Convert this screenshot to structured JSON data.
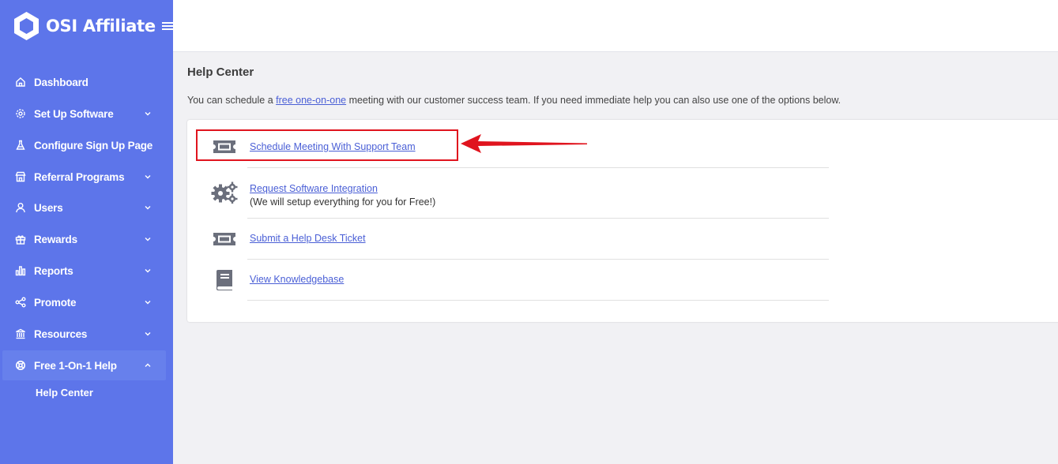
{
  "app": {
    "name": "OSI Affiliate"
  },
  "sidebar": {
    "items": [
      {
        "label": "Dashboard",
        "icon": "home-icon",
        "has_chevron": false
      },
      {
        "label": "Set Up Software",
        "icon": "settings-icon",
        "has_chevron": true
      },
      {
        "label": "Configure Sign Up Page",
        "icon": "flask-icon",
        "has_chevron": false
      },
      {
        "label": "Referral Programs",
        "icon": "store-icon",
        "has_chevron": true
      },
      {
        "label": "Users",
        "icon": "user-icon",
        "has_chevron": true
      },
      {
        "label": "Rewards",
        "icon": "gift-icon",
        "has_chevron": true
      },
      {
        "label": "Reports",
        "icon": "bar-chart-icon",
        "has_chevron": true
      },
      {
        "label": "Promote",
        "icon": "share-icon",
        "has_chevron": true
      },
      {
        "label": "Resources",
        "icon": "bank-icon",
        "has_chevron": true
      },
      {
        "label": "Free 1-On-1 Help",
        "icon": "lifebuoy-icon",
        "has_chevron": true,
        "expanded": true,
        "active": true
      }
    ],
    "sub_items": [
      {
        "label": "Help Center"
      }
    ]
  },
  "main": {
    "title": "Help Center",
    "intro_before": "You can schedule a ",
    "intro_link": "free one-on-one",
    "intro_after": " meeting with our customer success team. If you need immediate help you can also use one of the options below.",
    "options": [
      {
        "label": "Schedule Meeting With Support Team",
        "icon": "ticket-icon",
        "highlighted": true
      },
      {
        "label": "Request Software Integration",
        "note": "(We will setup everything for you for Free!)",
        "icon": "gears-icon"
      },
      {
        "label": "Submit a Help Desk Ticket",
        "icon": "ticket-icon"
      },
      {
        "label": "View Knowledgebase",
        "icon": "book-icon"
      }
    ]
  },
  "colors": {
    "sidebar_bg": "#5d75ea",
    "link": "#4a5fd6",
    "highlight": "#e0141e",
    "icon_gray": "#6b6f7c"
  }
}
